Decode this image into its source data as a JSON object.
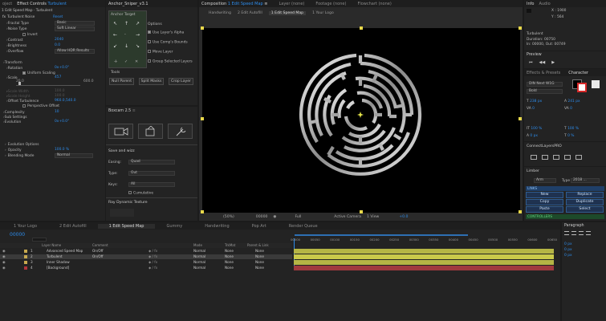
{
  "effect_controls": {
    "tab_prefix": "oject",
    "tab": "Effect Controls",
    "layer": "Turbulent",
    "header": "1 Edit Speed Map · Turbulent",
    "effect_name": "Turbulent Noise",
    "reset": "Reset",
    "props": [
      {
        "label": "Fractal Type",
        "select": "Basic"
      },
      {
        "label": "Noise Type",
        "select": "Soft Linear"
      },
      {
        "label": "",
        "check": "Invert"
      },
      {
        "label": "Contrast",
        "value": "2040"
      },
      {
        "label": "Brightness",
        "value": "0.0"
      },
      {
        "label": "Overflow",
        "select": "Allow HDR Results"
      },
      {
        "label": "Transform",
        "value": ""
      },
      {
        "label": "Rotation",
        "value": "0x+0.0°"
      },
      {
        "label": "",
        "check": "Uniform Scaling"
      },
      {
        "label": "Scale",
        "value": "457"
      },
      {
        "label": "Scale Width",
        "value": "100.0"
      },
      {
        "label": "Scale Height",
        "value": "100.0"
      },
      {
        "label": "Offset Turbulence",
        "value": "960.0,540.0"
      },
      {
        "label": "",
        "check": "Perspective Offset"
      },
      {
        "label": "Complexity",
        "value": "10"
      },
      {
        "label": "Sub Settings",
        "value": ""
      },
      {
        "label": "Evolution",
        "value": "0x+0.0°"
      }
    ],
    "scale_min": "20.0",
    "scale_max": "600.0",
    "evolution_options": "Evolution Options",
    "opacity_label": "Opacity",
    "opacity_value": "100.0 %",
    "blending_label": "Blending Mode",
    "blending_value": "Normal"
  },
  "anchor_panel": {
    "title": "Anchor_Sniper_v3.1",
    "anchor_target": "Anchor Target",
    "options_title": "Options",
    "options": [
      "Use Layer's Alpha",
      "Use Comp's Bounds",
      "Move Layer",
      "Group Selected Layers"
    ],
    "tools_title": "Tools",
    "tools": [
      "Null Parent",
      "Split Masks",
      "Crop Layer"
    ]
  },
  "boxcam": {
    "title": "Boxcam 2.5",
    "save_title": "Save and wizz",
    "easing_label": "Easing:",
    "easing_value": "Quad",
    "type_label": "Type:",
    "type_value": "Out",
    "keys_label": "Keys:",
    "keys_value": "All",
    "cumulative": "Cumulative",
    "ray_title": "Ray Dynamic Texture"
  },
  "composition": {
    "tab_prefix": "Composition",
    "tab_comp": "1 Edit Speed Map",
    "layer_tab": "Layer (none)",
    "footage_tab": "Footage (none)",
    "flowchart_tab": "Flowchart (none)",
    "breadcrumbs": [
      "Handwriting",
      "2 Edit Autofill",
      "1 Edit Speed Map",
      "1 Your Logo"
    ],
    "zoom": "(50%)",
    "timecode": "00000",
    "quality": "Full",
    "camera": "Active Camera",
    "view": "1 View",
    "exposure": "+0.0"
  },
  "info": {
    "tab": "Info",
    "audio_tab": "Audio",
    "x": "X : 1900",
    "y": "Y : 564",
    "layer_name": "Turbulent",
    "duration": "Duration: 00750",
    "in_out": "In: 00000, Out: 00749"
  },
  "preview": {
    "title": "Preview"
  },
  "effects_presets": {
    "title": "Effects & Presets",
    "character_tab": "Character"
  },
  "character": {
    "font": "DIN Next W1G",
    "style": "Bold",
    "size": "238 px",
    "leading": "241 px",
    "kerning": "0",
    "tracking": "0",
    "vscale": "100 %",
    "hscale": "100 %",
    "baseline": "0 px",
    "tsume": "0 %",
    "fill_color": "#ffffff",
    "stroke_color": "#d62828"
  },
  "connect": {
    "title": "ConnectLayersPRO"
  },
  "limber": {
    "title": "Limber",
    "arm": "Arm",
    "type": "Type",
    "type_value": "2018 ...",
    "links": "LINKS",
    "controllers": "CONTROLLERS",
    "buttons": [
      "New",
      "Replace",
      "Copy",
      "Duplicate",
      "Paste",
      "Select"
    ]
  },
  "paragraph": {
    "title": "Paragraph",
    "vals": [
      "0 px",
      "0 px",
      "0 px"
    ]
  },
  "timeline": {
    "tabs": [
      "1 Your Logo",
      "2 Edit Autofill",
      "1 Edit Speed Map",
      "Gummy",
      "Handwriting",
      "Pop Art",
      "Render Queue"
    ],
    "timecode": "00000",
    "col_layer": "Layer Name",
    "col_comment": "Comment",
    "col_mode": "Mode",
    "col_trkmat": "TrkMat",
    "col_parent": "Parent & Link",
    "layers": [
      {
        "num": "1",
        "name": "Advanced Speed Map",
        "comment": "On/Off",
        "mode": "Normal",
        "trkmat": "None",
        "parent": "None",
        "color": "#c7a94f"
      },
      {
        "num": "2",
        "name": "Turbulent",
        "comment": "On/Off",
        "mode": "Normal",
        "trkmat": "None",
        "parent": "None",
        "color": "#c7a94f"
      },
      {
        "num": "3",
        "name": "Inner Shadow",
        "comment": "",
        "mode": "Normal",
        "trkmat": "None",
        "parent": "None",
        "color": "#c7a94f"
      },
      {
        "num": "4",
        "name": "[Background]",
        "comment": "",
        "mode": "Normal",
        "trkmat": "None",
        "parent": "None",
        "color": "#b0353c"
      }
    ],
    "ruler": [
      "00000",
      "00050",
      "00100",
      "00150",
      "00200",
      "00250",
      "00300",
      "00350",
      "00400",
      "00450",
      "00500",
      "00550",
      "00600",
      "00650"
    ],
    "track_colors": [
      "#b5b545",
      "#c9c94a",
      "#b5b545",
      "#a03a3e"
    ]
  }
}
